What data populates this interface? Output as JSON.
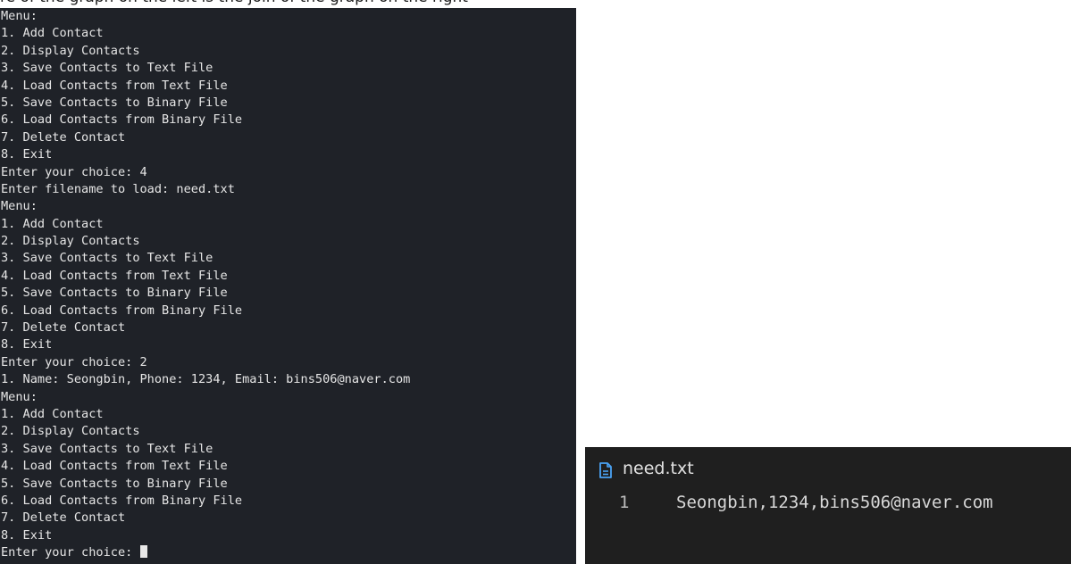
{
  "caption": "re of the graph on the left is the join of the graph on the right",
  "terminal": {
    "lines": [
      "Menu:",
      "1. Add Contact",
      "2. Display Contacts",
      "3. Save Contacts to Text File",
      "4. Load Contacts from Text File",
      "5. Save Contacts to Binary File",
      "6. Load Contacts from Binary File",
      "7. Delete Contact",
      "8. Exit",
      "Enter your choice: 4",
      "Enter filename to load: need.txt",
      "Menu:",
      "1. Add Contact",
      "2. Display Contacts",
      "3. Save Contacts to Text File",
      "4. Load Contacts from Text File",
      "5. Save Contacts to Binary File",
      "6. Load Contacts from Binary File",
      "7. Delete Contact",
      "8. Exit",
      "Enter your choice: 2",
      "1. Name: Seongbin, Phone: 1234, Email: bins506@naver.com",
      "Menu:",
      "1. Add Contact",
      "2. Display Contacts",
      "3. Save Contacts to Text File",
      "4. Load Contacts from Text File",
      "5. Save Contacts to Binary File",
      "6. Load Contacts from Binary File",
      "7. Delete Contact",
      "8. Exit"
    ],
    "prompt": "Enter your choice: "
  },
  "editor": {
    "tab_icon": "file-text-icon",
    "tab_name": "need.txt",
    "accent_color": "#4aa3f5",
    "line_number": "1",
    "line_content": "Seongbin,1234,bins506@naver.com"
  }
}
